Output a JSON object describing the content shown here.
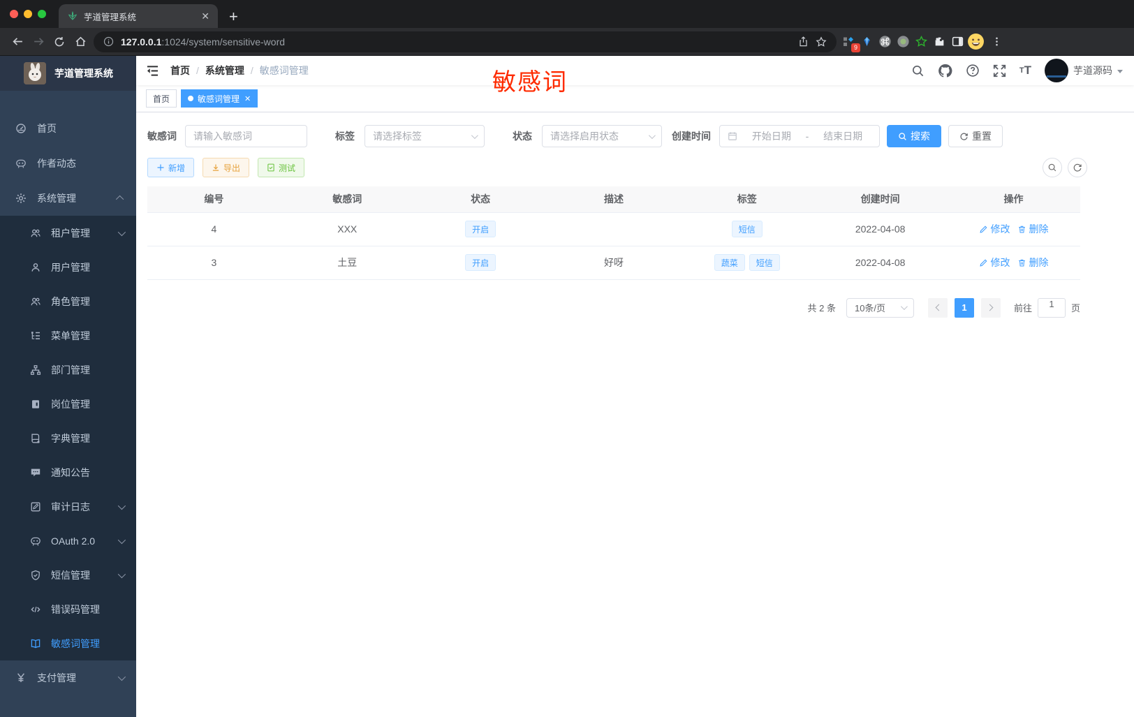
{
  "browser": {
    "tab_title": "芋道管理系统",
    "url_host": "127.0.0.1",
    "url_path": ":1024/system/sensitive-word",
    "extension_badge": "9"
  },
  "sidebar": {
    "logo_title": "芋道管理系统",
    "items": [
      {
        "key": "home",
        "icon": "dashboard",
        "label": "首页",
        "level": "top"
      },
      {
        "key": "author-news",
        "icon": "chat",
        "label": "作者动态",
        "level": "top"
      },
      {
        "key": "system",
        "icon": "gear",
        "label": "系统管理",
        "level": "top",
        "arrow": "up"
      },
      {
        "key": "tenant",
        "icon": "users",
        "label": "租户管理",
        "level": "sub",
        "arrow": "down"
      },
      {
        "key": "user",
        "icon": "user",
        "label": "用户管理",
        "level": "sub"
      },
      {
        "key": "role",
        "icon": "users",
        "label": "角色管理",
        "level": "sub"
      },
      {
        "key": "menu",
        "icon": "tree",
        "label": "菜单管理",
        "level": "sub"
      },
      {
        "key": "dept",
        "icon": "org",
        "label": "部门管理",
        "level": "sub"
      },
      {
        "key": "post",
        "icon": "badge",
        "label": "岗位管理",
        "level": "sub"
      },
      {
        "key": "dict",
        "icon": "dict",
        "label": "字典管理",
        "level": "sub"
      },
      {
        "key": "notice",
        "icon": "notice",
        "label": "通知公告",
        "level": "sub"
      },
      {
        "key": "audit-log",
        "icon": "log",
        "label": "审计日志",
        "level": "sub",
        "arrow": "down"
      },
      {
        "key": "oauth2",
        "icon": "robot",
        "label": "OAuth 2.0",
        "level": "sub",
        "arrow": "down"
      },
      {
        "key": "sms",
        "icon": "shield",
        "label": "短信管理",
        "level": "sub",
        "arrow": "down"
      },
      {
        "key": "error-code",
        "icon": "code",
        "label": "错误码管理",
        "level": "sub"
      },
      {
        "key": "sensitive-word",
        "icon": "book",
        "label": "敏感词管理",
        "level": "sub",
        "active": true
      },
      {
        "key": "pay",
        "icon": "yen",
        "label": "支付管理",
        "level": "top",
        "arrow": "down"
      }
    ]
  },
  "header": {
    "breadcrumb": [
      "首页",
      "系统管理",
      "敏感词管理"
    ],
    "annotation": "敏感词",
    "username": "芋道源码"
  },
  "tags": [
    {
      "label": "首页",
      "active": false,
      "closable": false
    },
    {
      "label": "敏感词管理",
      "active": true,
      "closable": true
    }
  ],
  "filters": {
    "keyword_label": "敏感词",
    "keyword_placeholder": "请输入敏感词",
    "tag_label": "标签",
    "tag_placeholder": "请选择标签",
    "status_label": "状态",
    "status_placeholder": "请选择启用状态",
    "date_label": "创建时间",
    "date_start_placeholder": "开始日期",
    "date_separator": "-",
    "date_end_placeholder": "结束日期",
    "search_label": "搜索",
    "reset_label": "重置"
  },
  "toolbar": {
    "add_label": "新增",
    "export_label": "导出",
    "test_label": "测试"
  },
  "table": {
    "columns": [
      "编号",
      "敏感词",
      "状态",
      "描述",
      "标签",
      "创建时间",
      "操作"
    ],
    "rows": [
      {
        "id": "4",
        "word": "XXX",
        "status": "开启",
        "description": "",
        "tags": [
          "短信"
        ],
        "created_at": "2022-04-08"
      },
      {
        "id": "3",
        "word": "土豆",
        "status": "开启",
        "description": "好呀",
        "tags": [
          "蔬菜",
          "短信"
        ],
        "created_at": "2022-04-08"
      }
    ],
    "edit_label": "修改",
    "delete_label": "删除"
  },
  "pagination": {
    "total_text": "共 2 条",
    "page_size_text": "10条/页",
    "current_page": "1",
    "goto_label": "前往",
    "goto_value": "1",
    "page_unit": "页"
  },
  "colors": {
    "primary": "#409eff",
    "warning": "#e6a23c",
    "success": "#67c23a",
    "annotation_red": "#fe2b00",
    "sidebar_bg": "#304156",
    "submenu_bg": "#1f2d3d"
  }
}
